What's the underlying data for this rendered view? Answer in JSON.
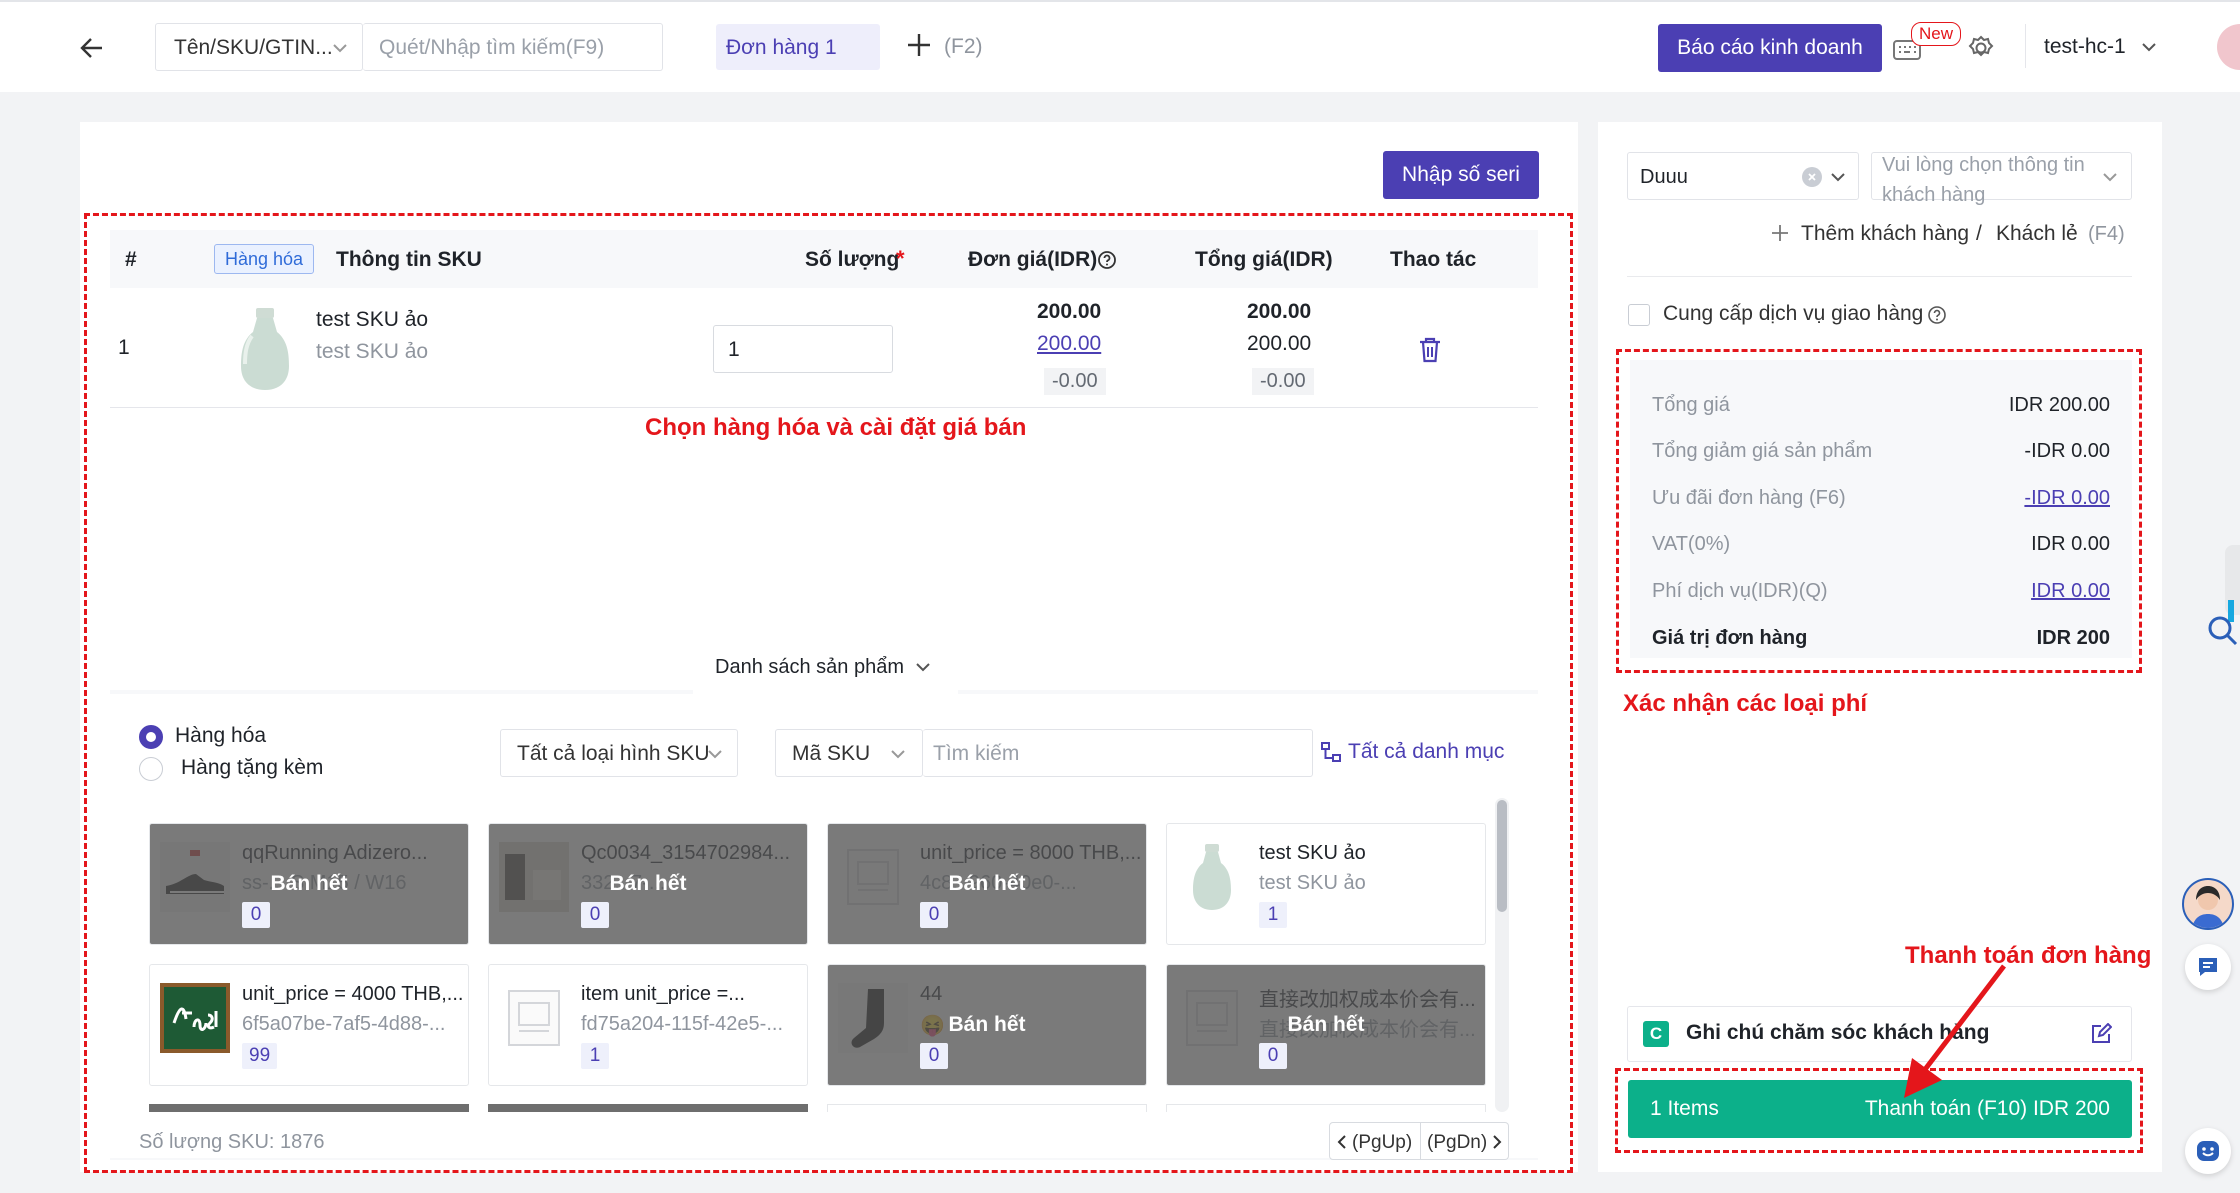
{
  "topbar": {
    "search_type": "Tên/SKU/GTIN...",
    "search_placeholder": "Quét/Nhập tìm kiếm(F9)",
    "order_tab": "Đơn hàng 1",
    "add_shortcut": "(F2)",
    "report_button": "Báo cáo kinh doanh",
    "new_badge": "New",
    "store_name": "test-hc-1"
  },
  "main": {
    "serial_button": "Nhập số seri",
    "table": {
      "headers": {
        "index": "#",
        "goods_tag": "Hàng hóa",
        "sku_info": "Thông tin SKU",
        "quantity": "Số lượng",
        "required_mark": "*",
        "unit_price": "Đơn giá(IDR)",
        "total_price": "Tổng giá(IDR)",
        "action": "Thao tác"
      },
      "row": {
        "index": "1",
        "name": "test SKU ảo",
        "sub": "test SKU ảo",
        "quantity": "1",
        "unit_price": "200.00",
        "unit_price_link": "200.00",
        "unit_discount": "-0.00",
        "total_price": "200.00",
        "total_price2": "200.00",
        "total_discount": "-0.00"
      }
    },
    "annotation_select": "Chọn hàng hóa và cài đặt giá bán"
  },
  "product_list": {
    "tab_label": "Danh sách sản phẩm",
    "radio_goods": "Hàng hóa",
    "radio_gift": "Hàng tặng kèm",
    "sku_type_select": "Tất cả loại hình SKU",
    "code_select": "Mã SKU",
    "search_placeholder": "Tìm kiếm",
    "all_categories": "Tất cả danh mục",
    "sku_count": "Số lượng SKU: 1876",
    "pgup": "(PgUp)",
    "pgdn": "(PgDn)",
    "sold_out": "Bán hết",
    "cards": [
      {
        "name": "qqRunning Adizero...",
        "sub": "ss-... S M15 / W16",
        "qty": "0",
        "sold_out": true,
        "thumb": "shoe"
      },
      {
        "name": "Qc0034_3154702984...",
        "sub": "332...7-...",
        "qty": "0",
        "sold_out": true,
        "thumb": "room"
      },
      {
        "name": "unit_price = 8000 THB,...",
        "sub": "4c8...960-40e0-...",
        "qty": "0",
        "sold_out": true,
        "thumb": "placeholder"
      },
      {
        "name": "test SKU ảo",
        "sub": "test SKU ảo",
        "qty": "1",
        "sold_out": false,
        "thumb": "bottle"
      },
      {
        "name": "unit_price = 4000 THB,...",
        "sub": "6f5a07be-7af5-4d88-...",
        "qty": "99",
        "sold_out": false,
        "thumb": "chalkboard"
      },
      {
        "name": "item unit_price =...",
        "sub": "fd75a204-115f-42e5-...",
        "qty": "1",
        "sold_out": false,
        "thumb": "placeholder"
      },
      {
        "name": "44",
        "sub": "😝",
        "qty": "0",
        "sold_out": true,
        "thumb": "sock"
      },
      {
        "name": "直接改加权成本价会有...",
        "sub": "直接改加权成本价会有...",
        "qty": "0",
        "sold_out": true,
        "thumb": "placeholder"
      }
    ]
  },
  "right": {
    "customer_value": "Duuu",
    "customer_info_placeholder": "Vui lòng chọn thông tin khách hàng",
    "add_customer": "Thêm khách hàng",
    "separator": "/",
    "walk_in": "Khách lẻ",
    "walk_in_key": "(F4)",
    "delivery_service": "Cung cấp dịch vụ giao hàng",
    "summary": {
      "total_label": "Tổng giá",
      "total_value": "IDR 200.00",
      "product_discount_label": "Tổng giảm giá sản phẩm",
      "product_discount_value": "-IDR 0.00",
      "order_discount_label": "Ưu đãi đơn hàng (F6)",
      "order_discount_value": "-IDR 0.00",
      "vat_label": "VAT(0%)",
      "vat_value": "IDR 0.00",
      "service_fee_label": "Phí dịch vụ(IDR)(Q)",
      "service_fee_value": "IDR 0.00",
      "order_value_label": "Giá trị đơn hàng",
      "order_value_value": "IDR 200"
    },
    "annotation_fees": "Xác nhận các loại phí",
    "annotation_pay": "Thanh toán đơn hàng",
    "care_note_badge": "C",
    "care_note": "Ghi chú chăm sóc khách hàng",
    "items_count": "1 Items",
    "pay_button": "Thanh toán (F10) IDR 200"
  },
  "colors": {
    "accent": "#4b3fb3",
    "annotation_red": "#e4161b",
    "pay_green": "#0cb08a"
  }
}
